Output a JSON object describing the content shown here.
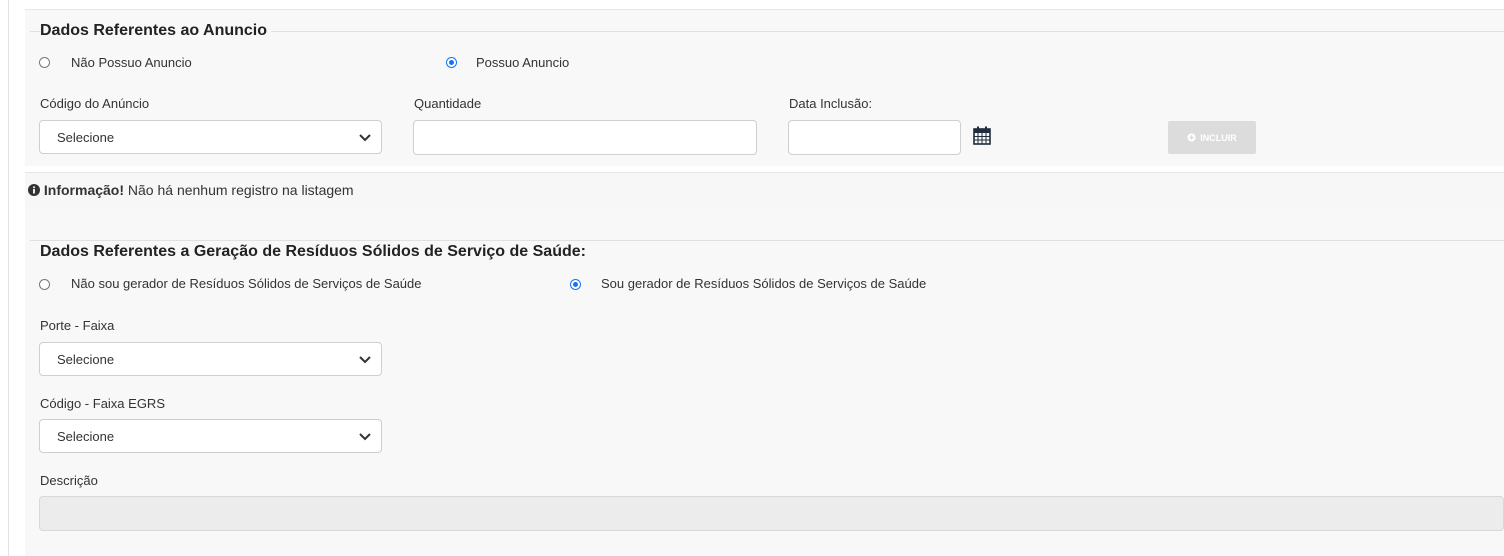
{
  "anuncio": {
    "title": "Dados Referentes ao Anuncio",
    "radio_no": "Não Possuo Anuncio",
    "radio_yes": "Possuo Anuncio",
    "selected": "yes",
    "codigo_label": "Código do Anúncio",
    "codigo_value": "Selecione",
    "quantidade_label": "Quantidade",
    "quantidade_value": "",
    "data_label": "Data Inclusão:",
    "data_value": "",
    "incluir_label": "INCLUIR"
  },
  "info": {
    "strong": "Informação!",
    "message": "Não há nenhum registro na listagem"
  },
  "residuos": {
    "title": "Dados Referentes a Geração de Resíduos Sólidos de Serviço de Saúde:",
    "radio_no": "Não sou gerador de Resíduos Sólidos de Serviços de Saúde",
    "radio_yes": "Sou gerador de Resíduos Sólidos de Serviços de Saúde",
    "selected": "yes",
    "porte_label": "Porte - Faixa",
    "porte_value": "Selecione",
    "codigo_label": "Código - Faixa EGRS",
    "codigo_value": "Selecione",
    "descricao_label": "Descrição",
    "descricao_value": ""
  },
  "icons": {
    "calendar": "calendar-icon",
    "info": "info-circle-icon",
    "chevron": "chevron-down-icon",
    "plus": "plus-circle-icon"
  },
  "colors": {
    "accent": "#1a73e8",
    "disabled_button": "#dcdcdc",
    "panel_bg": "#f8f8f8"
  }
}
